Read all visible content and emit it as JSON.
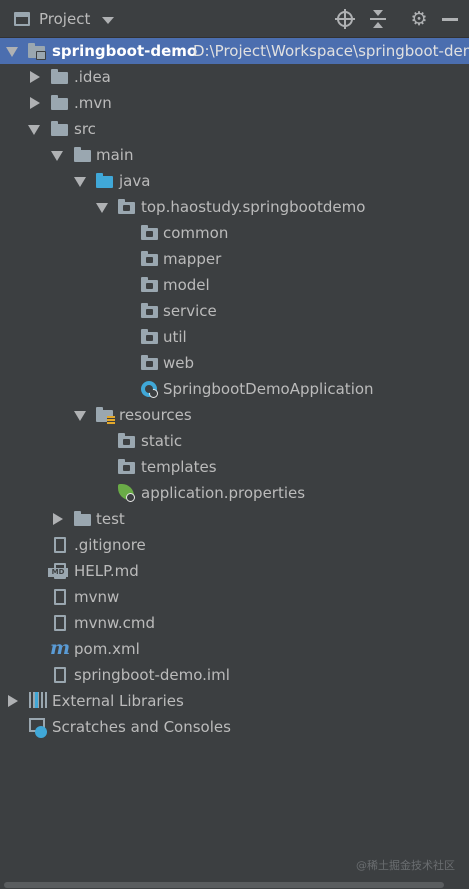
{
  "toolbar": {
    "title": "Project"
  },
  "project": {
    "name": "springboot-demo",
    "path": "D:\\Project\\Workspace\\springboot-demo"
  },
  "tree": {
    "idea": ".idea",
    "mvn": ".mvn",
    "src": "src",
    "main": "main",
    "java": "java",
    "package": "top.haostudy.springbootdemo",
    "common": "common",
    "mapper": "mapper",
    "model": "model",
    "service": "service",
    "util": "util",
    "web": "web",
    "app_class": "SpringbootDemoApplication",
    "resources": "resources",
    "static": "static",
    "templates": "templates",
    "app_props": "application.properties",
    "test": "test",
    "gitignore": ".gitignore",
    "help": "HELP.md",
    "mvnw": "mvnw",
    "mvnw_cmd": "mvnw.cmd",
    "pom": "pom.xml",
    "iml": "springboot-demo.iml",
    "external_libraries": "External Libraries",
    "scratches": "Scratches and Consoles"
  },
  "icons": {
    "md_badge": "MD",
    "maven": "m"
  },
  "watermark": "@稀土掘金技术社区",
  "colors": {
    "background": "#3c3f41",
    "selection": "#4b6eaf",
    "source_folder": "#40a8d8",
    "spring": "#6aab47"
  }
}
